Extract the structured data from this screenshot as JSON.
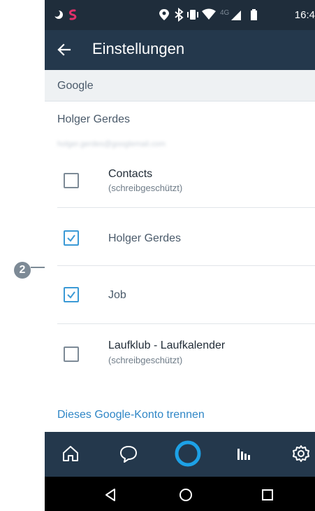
{
  "statusbar": {
    "time": "16:4",
    "network": "4G",
    "icons": [
      "moon-icon",
      "s-app-icon",
      "location-icon",
      "bluetooth-icon",
      "vibrate-icon",
      "wifi-icon",
      "signal-icon",
      "battery-icon"
    ]
  },
  "appbar": {
    "title": "Einstellungen",
    "back_icon": "arrow-left-icon"
  },
  "section": {
    "title": "Google"
  },
  "account": {
    "name": "Holger Gerdes",
    "email": "holger.gerdes@googlemail.com"
  },
  "calendars": [
    {
      "label": "Contacts",
      "sub": "(schreibgeschützt)",
      "checked": false
    },
    {
      "label": "Holger Gerdes",
      "sub": "",
      "checked": true
    },
    {
      "label": "Job",
      "sub": "",
      "checked": true
    },
    {
      "label": "Laufklub - Laufkalender",
      "sub": "(schreibgeschützt)",
      "checked": false
    }
  ],
  "disconnect_label": "Dieses Google-Konto trennen",
  "bottom_nav": [
    "home-icon",
    "chat-icon",
    "alexa-icon",
    "music-icon",
    "settings-icon"
  ],
  "system_nav": [
    "back-triangle-icon",
    "home-circle-icon",
    "recents-square-icon"
  ],
  "annotation": {
    "badge": "2"
  },
  "colors": {
    "statusbar": "#1f2d3b",
    "appbar": "#24384c",
    "accent": "#3b9ad6",
    "link": "#2f86c6",
    "alexa_ring": "#1da1e6"
  }
}
